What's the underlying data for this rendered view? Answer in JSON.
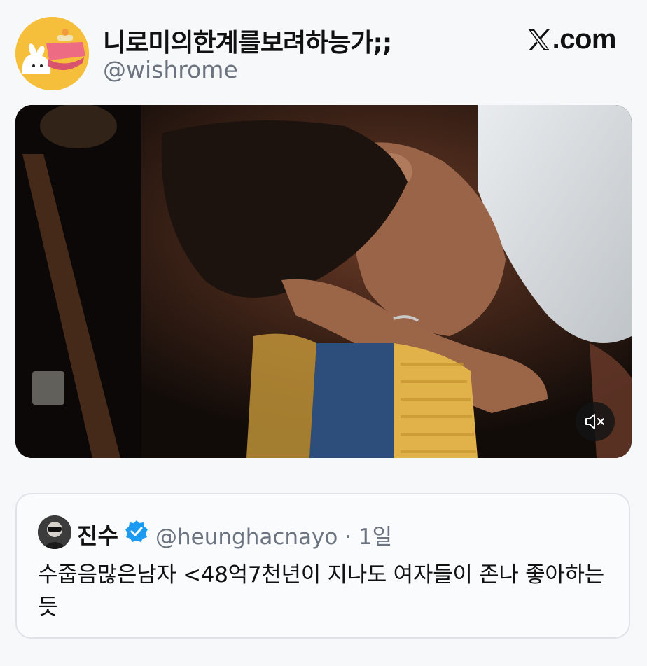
{
  "post": {
    "display_name": "니로미의한계를보려하능가;;",
    "handle": "@wishrome",
    "brand": ".com",
    "avatar_icon": "bunny-kotatsu-avatar",
    "x_logo_icon": "x-logo-icon"
  },
  "media": {
    "type": "video",
    "mute_icon": "speaker-muted-icon",
    "muted": true
  },
  "quote": {
    "name": "진수",
    "verified": true,
    "handle_meta": "@heunghacnayo · 1일",
    "text": "수줍음많은남자 <48억7천년이 지나도 여자들이 존나 좋아하는듯"
  },
  "colors": {
    "avatar_bg": "#f6bf3b",
    "verified": "#1d9bf0",
    "secondary_text": "#6b7480"
  }
}
